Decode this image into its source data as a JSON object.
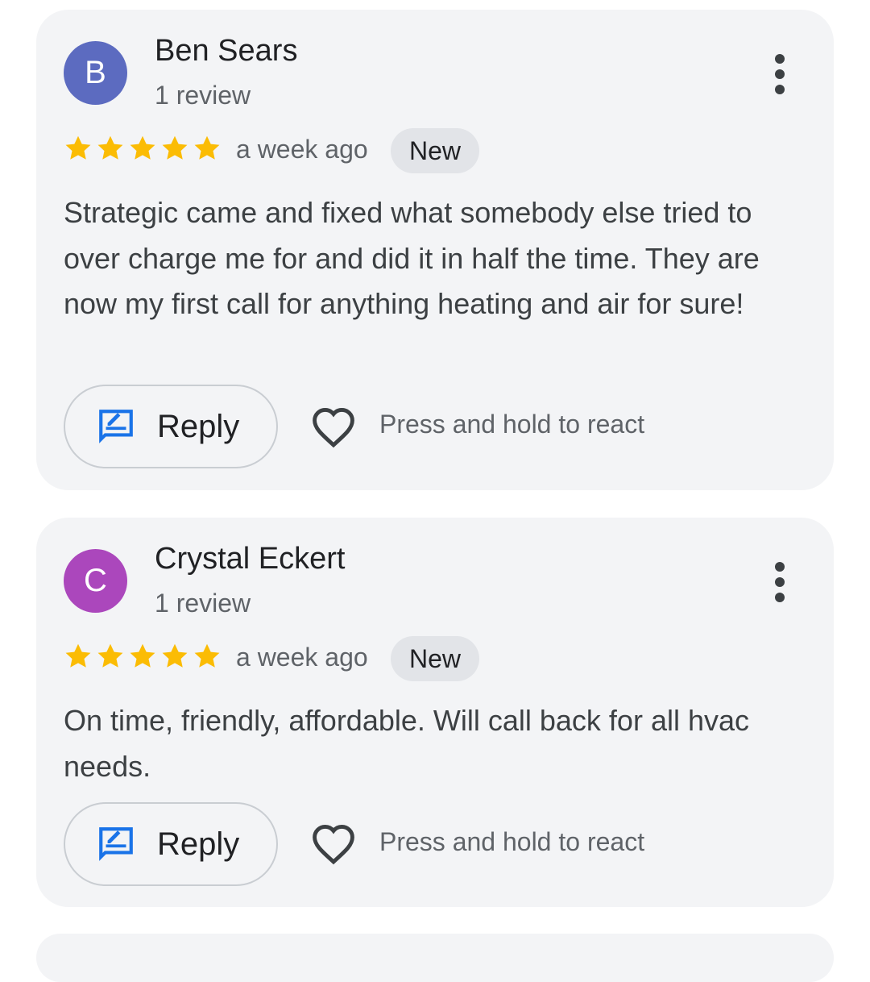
{
  "reviews": [
    {
      "avatar_letter": "B",
      "avatar_color": "#5c6bc0",
      "name": "Ben Sears",
      "review_count": "1 review",
      "rating": 5,
      "date": "a week ago",
      "badge": "New",
      "text": "Strategic came and fixed what somebody else tried to over charge me for and did it in half the time. They are now my first call for anything heating and air for sure!",
      "reply_label": "Reply",
      "react_label": "Press and hold to react"
    },
    {
      "avatar_letter": "C",
      "avatar_color": "#ab47bc",
      "name": "Crystal Eckert",
      "review_count": "1 review",
      "rating": 5,
      "date": "a week ago",
      "badge": "New",
      "text": "On time, friendly, affordable. Will call back for all hvac needs.",
      "reply_label": "Reply",
      "react_label": "Press and hold to react"
    }
  ],
  "colors": {
    "star": "#fbbc04",
    "reply_icon": "#1a73e8",
    "card_bg": "#f3f4f6",
    "badge_bg": "#e2e4e8"
  },
  "icons": {
    "more": "more-vert-icon",
    "star": "star-icon",
    "reply": "reply-chat-edit-icon",
    "react": "heart-outline-icon"
  }
}
